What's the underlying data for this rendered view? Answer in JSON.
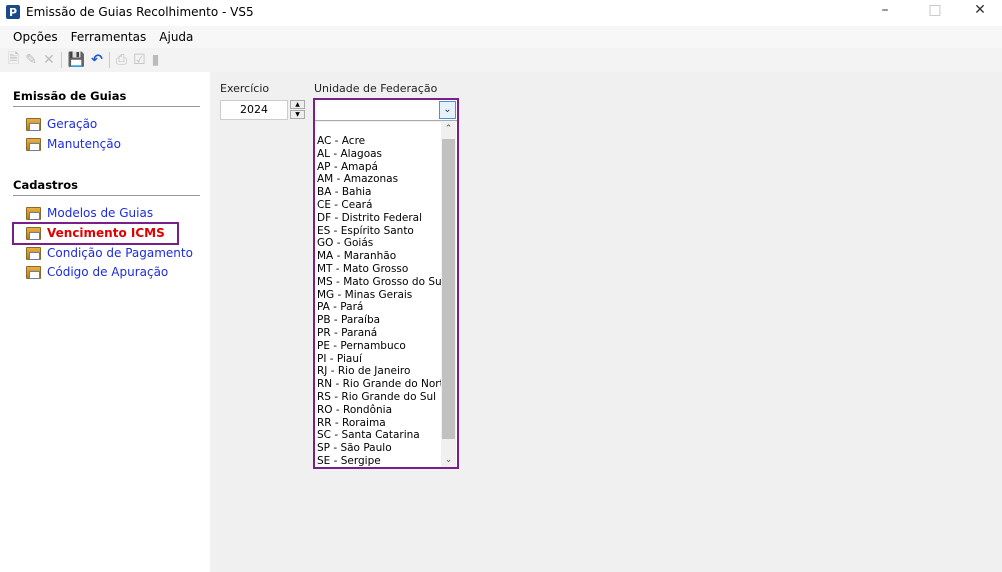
{
  "window": {
    "title": "Emissão de Guias Recolhimento - VS5",
    "logo": "P"
  },
  "menu": [
    {
      "label": "Opções"
    },
    {
      "label": "Ferramentas"
    },
    {
      "label": "Ajuda"
    }
  ],
  "sidebar": {
    "section1": "Emissão de Guias",
    "items1": [
      {
        "label": "Geração"
      },
      {
        "label": "Manutenção"
      }
    ],
    "section2": "Cadastros",
    "items2": [
      {
        "label": "Modelos de Guias"
      },
      {
        "label": "Vencimento ICMS"
      },
      {
        "label": "Condição de Pagamento"
      },
      {
        "label": "Código de Apuração"
      }
    ]
  },
  "form": {
    "exercicio_label": "Exercício",
    "exercicio_value": "2024",
    "uf_label": "Unidade de Federação",
    "uf_value": ""
  },
  "uf_options": [
    "AC - Acre",
    "AL - Alagoas",
    "AP - Amapá",
    "AM - Amazonas",
    "BA - Bahia",
    "CE - Ceará",
    "DF - Distrito Federal",
    "ES - Espírito Santo",
    "GO - Goiás",
    "MA - Maranhão",
    "MT - Mato Grosso",
    "MS - Mato Grosso do Sul",
    "MG - Minas Gerais",
    "PA - Pará",
    "PB - Paraíba",
    "PR - Paraná",
    "PE - Pernambuco",
    "PI - Piauí",
    "RJ - Rio de Janeiro",
    "RN - Rio Grande do Norte",
    "RS - Rio Grande do Sul",
    "RO - Rondônia",
    "RR - Roraima",
    "SC - Santa Catarina",
    "SP - São Paulo",
    "SE - Sergipe"
  ],
  "colors": {
    "highlight": "#7a1e8c",
    "link": "#1d2ce0",
    "active": "#e00000"
  }
}
